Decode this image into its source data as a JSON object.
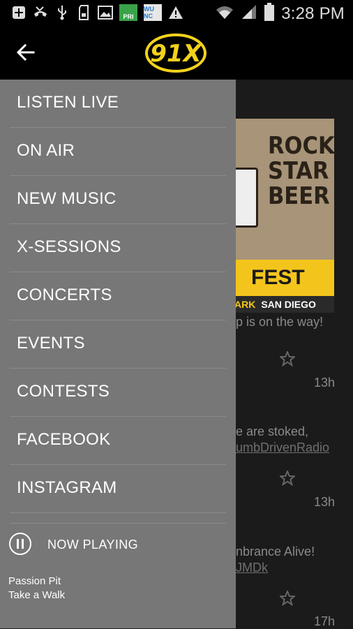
{
  "status_bar": {
    "time": "3:28 PM",
    "left_icons": [
      "add-box-icon",
      "missed-call-icon",
      "usb-icon",
      "sd-card-icon",
      "image-icon",
      "pri-app-icon",
      "wunc-app-icon",
      "warning-icon"
    ],
    "pri_label": "PRI",
    "wunc_label": "WU NC",
    "right_icons": [
      "wifi-icon",
      "signal-icon",
      "battery-icon"
    ]
  },
  "app_bar": {
    "logo_text": "91X"
  },
  "background": {
    "poster_lines": [
      "ROCK",
      "STAR",
      "BEER"
    ],
    "poster_fest": "FEST",
    "poster_place_partial": "ARK",
    "poster_city": "SAN DIEGO",
    "feed": [
      {
        "text": "p is on the way!",
        "time": "13h"
      },
      {
        "text": "e are stoked,",
        "link": "umbDrivenRadio",
        "time": "13h"
      },
      {
        "text": "nbrance Alive!",
        "link": "JMDk",
        "time": "17h"
      }
    ]
  },
  "drawer": {
    "menu": [
      "LISTEN LIVE",
      "ON AIR",
      "NEW MUSIC",
      "X-SESSIONS",
      "CONCERTS",
      "EVENTS",
      "CONTESTS",
      "FACEBOOK",
      "INSTAGRAM"
    ],
    "now_playing_label": "NOW PLAYING",
    "artist": "Passion Pit",
    "song": "Take a Walk"
  },
  "colors": {
    "drawer_bg": "#777777",
    "app_bar_bg": "#000000",
    "logo_yellow": "#f3d21c",
    "content_bg": "#1b1b1b"
  }
}
